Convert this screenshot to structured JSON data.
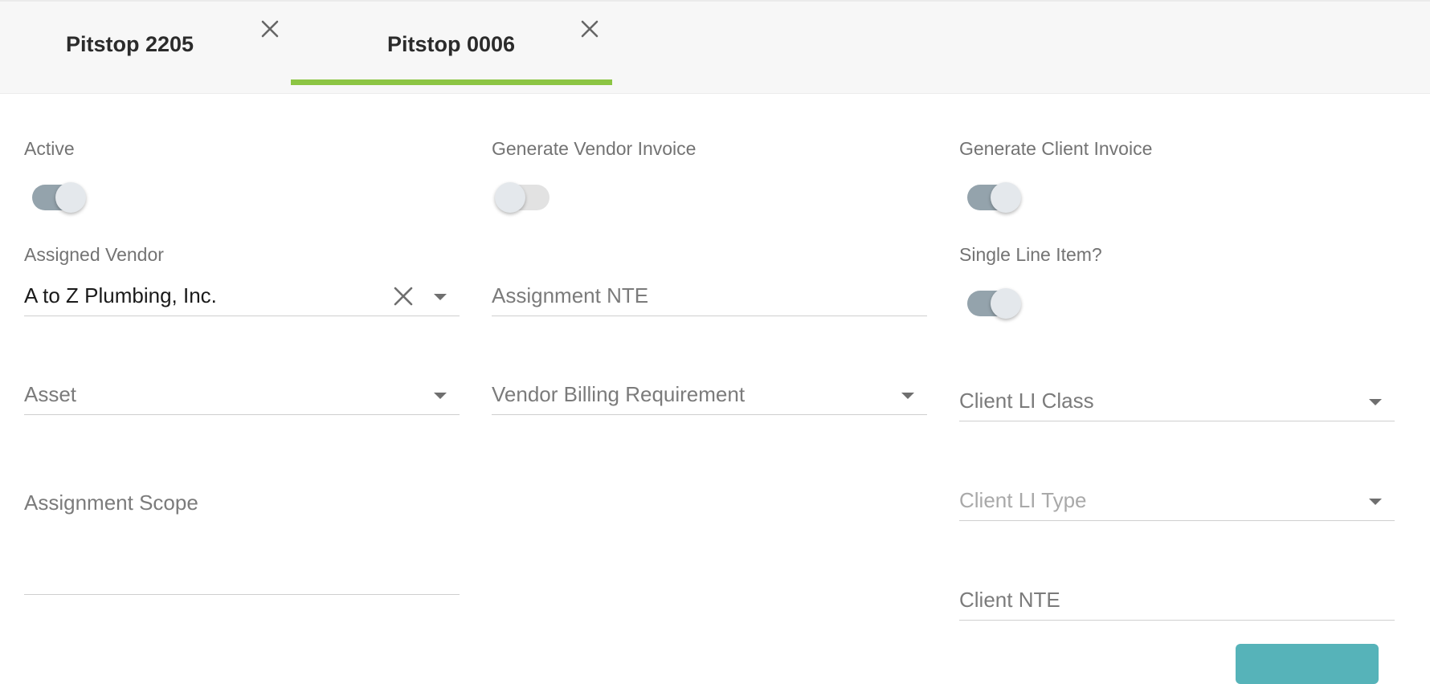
{
  "tabs": [
    {
      "label": "Pitstop 2205",
      "active": false
    },
    {
      "label": "Pitstop 0006",
      "active": true
    }
  ],
  "colors": {
    "tab_indicator": "#8cc543",
    "toggle_on_track": "#94a3ac",
    "toggle_off_track": "#e2e2e2",
    "submit_button": "#56b3b9"
  },
  "icons": {
    "tab_close": "close-icon",
    "clear": "close-icon",
    "dropdown": "caret-down-icon"
  },
  "form": {
    "active": {
      "label": "Active",
      "on": true
    },
    "generate_vendor_invoice": {
      "label": "Generate Vendor Invoice",
      "on": false
    },
    "generate_client_invoice": {
      "label": "Generate Client Invoice",
      "on": true
    },
    "assigned_vendor": {
      "label": "Assigned Vendor",
      "value": "A to Z Plumbing, Inc."
    },
    "assignment_nte": {
      "placeholder": "Assignment NTE"
    },
    "single_line_item": {
      "label": "Single Line Item?",
      "on": true
    },
    "asset": {
      "placeholder": "Asset"
    },
    "vendor_billing_requirement": {
      "placeholder": "Vendor Billing Requirement"
    },
    "client_li_class": {
      "placeholder": "Client LI Class"
    },
    "assignment_scope": {
      "placeholder": "Assignment Scope"
    },
    "client_li_type": {
      "placeholder": "Client LI Type"
    },
    "client_nte": {
      "placeholder": "Client NTE"
    }
  }
}
